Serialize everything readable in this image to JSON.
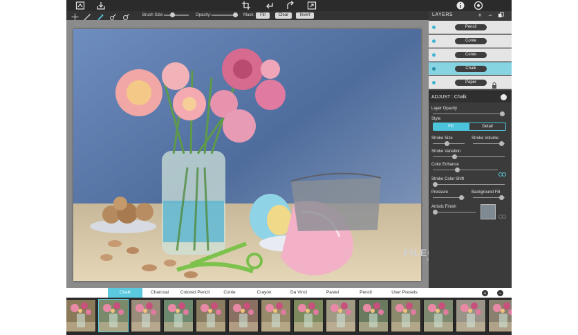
{
  "toolbar": {
    "icons": [
      "image-import-icon",
      "save-download-icon",
      "crop-icon",
      "undo-icon",
      "redo-icon",
      "fit-screen-icon",
      "info-icon",
      "settings-icon"
    ]
  },
  "tool_row": {
    "brush_size_label": "Brush Size:",
    "opacity_label": "Opacity:",
    "mask_label": "Mask:",
    "fill_button": "Fill",
    "clear_button": "Clear",
    "invert_button": "Invert",
    "brush_size_value": 0.35,
    "opacity_value": 0.9
  },
  "layers": {
    "title": "LAYERS",
    "items": [
      {
        "label": "Pencil",
        "selected": false
      },
      {
        "label": "Conte",
        "selected": false
      },
      {
        "label": "Conte",
        "selected": false
      },
      {
        "label": "Chalk",
        "selected": true
      },
      {
        "label": "Paper",
        "selected": false,
        "locked": true
      }
    ]
  },
  "adjust": {
    "title": "ADJUST : Chalk",
    "layer_opacity": "Layer Opacity",
    "style": "Style",
    "style_fill": "Fill",
    "style_detail": "Detail",
    "stroke_size": "Stroke Size",
    "stroke_volume": "Stroke Volume",
    "stroke_variation": "Stroke Variation",
    "color_enhance": "Color Enhance",
    "stroke_color_shift": "Stroke Color Shift",
    "pressure": "Pressure",
    "background_fill": "Background Fill",
    "artistic_finish": "Artistic Finish",
    "values": {
      "layer_opacity": 0.97,
      "stroke_size": 0.45,
      "stroke_volume": 0.9,
      "stroke_variation": 0.3,
      "color_enhance": 0.38,
      "stroke_color_shift": 0.02,
      "pressure": 0.9,
      "background_fill": 0.9,
      "artistic_finish": 0.05
    }
  },
  "presets": {
    "tabs": [
      "Chalk",
      "Charcoal",
      "Colored Pencil",
      "Conte",
      "Crayon",
      "Da Vinci",
      "Pastel",
      "Pencil",
      "User Presets"
    ],
    "active": "Chalk"
  },
  "watermark": {
    "main": "FILECR",
    "sub": ".com"
  },
  "colors": {
    "accent": "#5ac9dd",
    "panel": "#3b3b3b",
    "toolbar": "#2b2b2b",
    "canvas_bg": "#8b8b8b"
  }
}
